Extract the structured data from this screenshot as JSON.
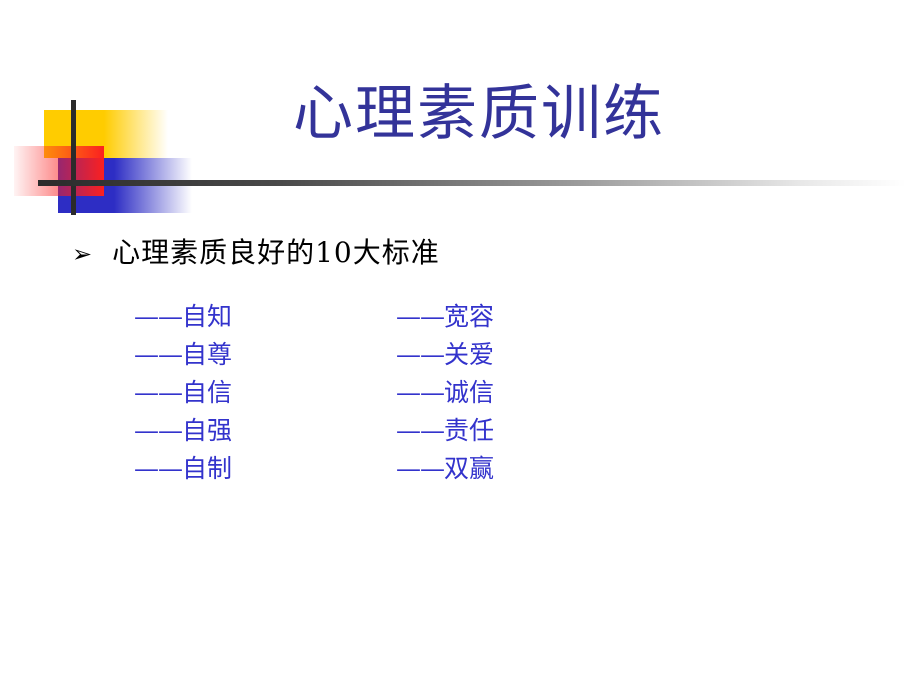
{
  "slide": {
    "title": "心理素质训练",
    "title_color": "#333399",
    "background_color": "#ffffff"
  },
  "heading": {
    "bullet_marker": "➢",
    "bullet_icon_name": "arrow-bullet-icon",
    "text": "心理素质良好的10大标准",
    "color": "#000000"
  },
  "ornament": {
    "yellow_color": "#ffcc00",
    "blue_color": "#2d2dc4",
    "red_color": "#fb2020",
    "rule_color": "#2b2b2b"
  },
  "standards": {
    "text_color": "#3333cc",
    "dash_prefix": "——",
    "left_column": [
      {
        "dash": "——",
        "term": "自知"
      },
      {
        "dash": "——",
        "term": "自尊"
      },
      {
        "dash": "——",
        "term": "自信"
      },
      {
        "dash": "——",
        "term": "自强"
      },
      {
        "dash": "——",
        "term": "自制"
      }
    ],
    "right_column": [
      {
        "dash": "——",
        "term": "宽容"
      },
      {
        "dash": "——",
        "term": "关爱"
      },
      {
        "dash": "——",
        "term": "诚信"
      },
      {
        "dash": "——",
        "term": "责任"
      },
      {
        "dash": "——",
        "term": "双赢"
      }
    ]
  }
}
